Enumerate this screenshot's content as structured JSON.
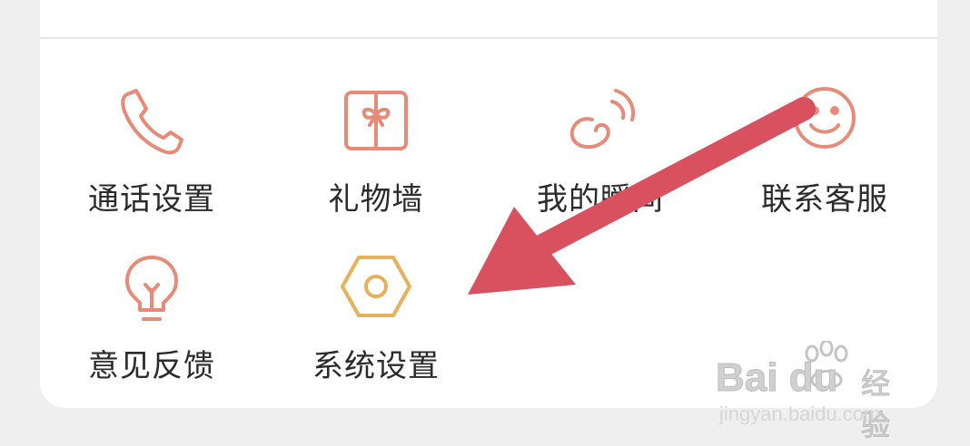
{
  "menu": {
    "items": [
      {
        "label": "通话设置",
        "icon": "phone-icon"
      },
      {
        "label": "礼物墙",
        "icon": "gift-icon"
      },
      {
        "label": "我的瞬间",
        "icon": "moments-icon"
      },
      {
        "label": "联系客服",
        "icon": "smile-icon"
      },
      {
        "label": "意见反馈",
        "icon": "lightbulb-icon"
      },
      {
        "label": "系统设置",
        "icon": "hexagon-nut-icon"
      }
    ]
  },
  "annotation": {
    "arrow_color": "#d9505f",
    "points_to": "系统设置"
  },
  "watermark": {
    "brand": "Bai du",
    "product": "经验",
    "url": "jingyan.baidu.com"
  },
  "colors": {
    "icon_salmon": "#e88a78",
    "icon_gold": "#e6b15a",
    "label_text": "#2b2b2b"
  }
}
